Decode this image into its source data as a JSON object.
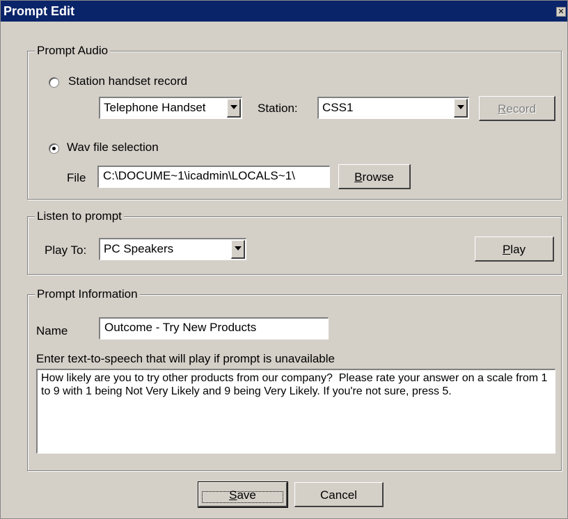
{
  "window": {
    "title": "Prompt Edit",
    "close_glyph": "✕"
  },
  "prompt_audio": {
    "legend": "Prompt Audio",
    "station_handset_label": "Station handset record",
    "station_handset_selected": false,
    "device_select": "Telephone Handset",
    "station_label": "Station:",
    "station_select": "CSS1",
    "record_button": "Record",
    "record_enabled": false,
    "wav_label": "Wav file selection",
    "wav_selected": true,
    "file_label": "File",
    "file_path": "C:\\DOCUME~1\\icadmin\\LOCALS~1\\",
    "browse_button": "Browse"
  },
  "listen": {
    "legend": "Listen to prompt",
    "play_to_label": "Play To:",
    "play_to_select": "PC Speakers",
    "play_button": "Play"
  },
  "prompt_info": {
    "legend": "Prompt Information",
    "name_label": "Name",
    "name_value": "Outcome - Try New Products",
    "tts_label": "Enter text-to-speech that will play if prompt is unavailable",
    "tts_text": "How likely are you to try other products from our company?  Please rate your answer on a scale from 1 to 9 with 1 being Not Very Likely and 9 being Very Likely. If you're not sure, press 5."
  },
  "footer": {
    "save_button": "Save",
    "cancel_button": "Cancel"
  }
}
